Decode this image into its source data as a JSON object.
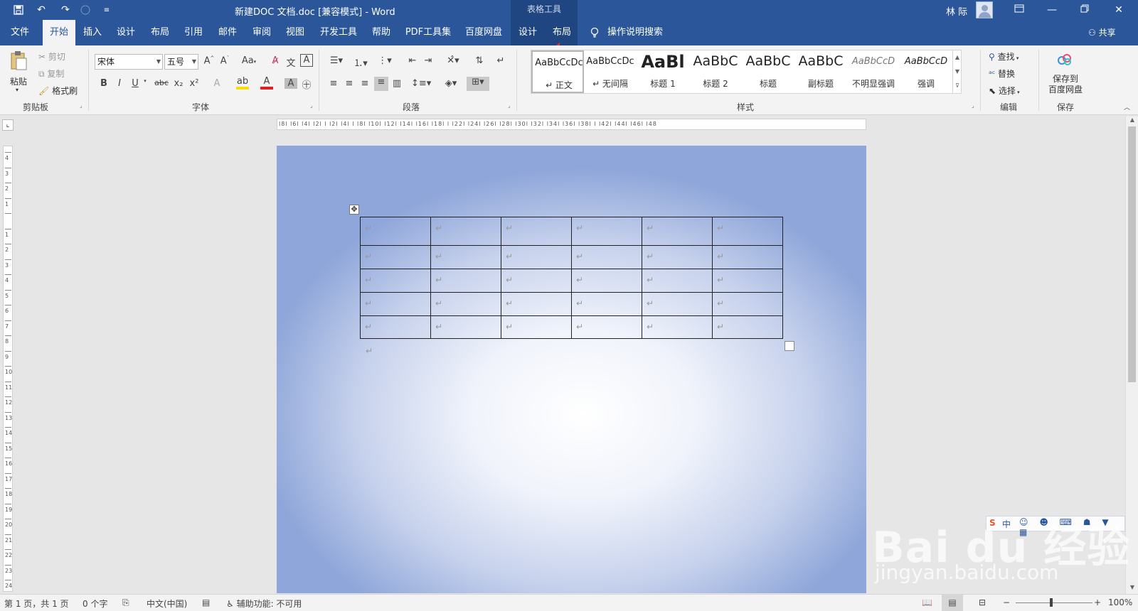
{
  "titlebar": {
    "quick_access": [
      "save-icon",
      "undo-icon",
      "redo-icon",
      "circle-icon",
      "customize-icon"
    ],
    "window_title": "新建DOC 文档.doc [兼容模式] - Word",
    "context_tab_title": "表格工具",
    "user_name": "林 际",
    "window_buttons": [
      "ribbon-display-icon",
      "minimize-icon",
      "restore-icon",
      "close-icon"
    ]
  },
  "menubar": {
    "items": [
      "文件",
      "开始",
      "插入",
      "设计",
      "布局",
      "引用",
      "邮件",
      "审阅",
      "视图",
      "开发工具",
      "帮助",
      "PDF工具集",
      "百度网盘",
      "设计",
      "布局"
    ],
    "active_index": 1,
    "search_label": "操作说明搜索",
    "share_label": "共享"
  },
  "ribbon": {
    "clipboard": {
      "paste": "粘贴",
      "cut": "剪切",
      "copy": "复制",
      "format_painter": "格式刷",
      "label": "剪贴板"
    },
    "font": {
      "font_name": "宋体",
      "font_size": "五号",
      "label": "字体",
      "bold": "B",
      "italic": "I",
      "underline": "U",
      "strike": "abc",
      "sub": "x₂",
      "sup": "x²",
      "case": "Aa",
      "grow": "A^",
      "shrink": "Aˇ",
      "wen": "文",
      "border_a": "A"
    },
    "paragraph": {
      "label": "段落"
    },
    "styles": {
      "label": "样式",
      "items": [
        {
          "sample": "AaBbCcDc",
          "name": "↵ 正文"
        },
        {
          "sample": "AaBbCcDc",
          "name": "↵ 无间隔"
        },
        {
          "sample": "AaBl",
          "name": "标题 1"
        },
        {
          "sample": "AaBbC",
          "name": "标题 2"
        },
        {
          "sample": "AaBbC",
          "name": "标题"
        },
        {
          "sample": "AaBbC",
          "name": "副标题"
        },
        {
          "sample": "AaBbCcD",
          "name": "不明显强调"
        },
        {
          "sample": "AaBbCcD",
          "name": "强调"
        }
      ]
    },
    "editing": {
      "find": "查找",
      "replace": "替换",
      "select": "选择",
      "label": "编辑"
    },
    "save": {
      "button": "保存到\n百度网盘",
      "label": "保存"
    }
  },
  "ruler": {
    "text": "l8l l6l l4l l2l  l  l2l l4l  l  l8l l10l l12l  l14l l16l l18l  l  l22l l24l l26l l28l l30l l32l l34l l36l l38l  l  l42l l44l l46l l48"
  },
  "vruler": {
    "numbers": [
      "4",
      "3",
      "2",
      "1",
      "",
      "1",
      "2",
      "3",
      "4",
      "5",
      "6",
      "7",
      "8",
      "9",
      "10",
      "11",
      "12",
      "13",
      "14",
      "15",
      "16",
      "17",
      "18",
      "19",
      "20",
      "21",
      "22",
      "23",
      "24"
    ]
  },
  "document": {
    "table": {
      "rows": 5,
      "cols": 6,
      "cell_mark": "↵"
    },
    "after_table_mark": "↵"
  },
  "statusbar": {
    "page": "第 1 页，共 1 页",
    "words": "0 个字",
    "language": "中文(中国)",
    "accessibility": "辅助功能: 不可用",
    "zoom": "100%"
  },
  "watermark": {
    "logo": "Bai du 经验",
    "url": "jingyan.baidu.com"
  },
  "ime": {
    "label": "中"
  },
  "colors": {
    "accent": "#2b579a",
    "context_tab": "#1f4680",
    "annotation_arrow": "#e03030"
  }
}
